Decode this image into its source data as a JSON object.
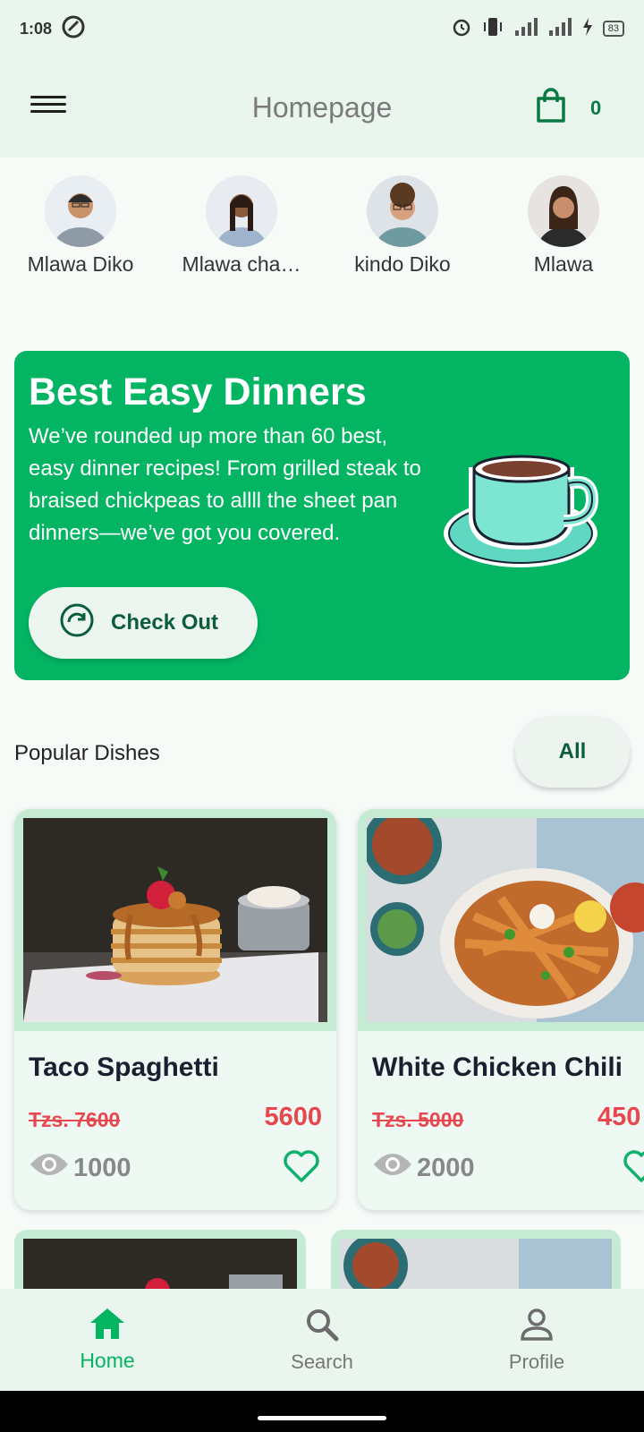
{
  "status": {
    "time": "1:08",
    "battery": "83"
  },
  "appbar": {
    "title": "Homepage",
    "cart_count": "0"
  },
  "stories": [
    {
      "name": "Mlawa Diko"
    },
    {
      "name": "Mlawa cha…"
    },
    {
      "name": "kindo Diko"
    },
    {
      "name": "Mlawa"
    }
  ],
  "banner": {
    "title": "Best Easy Dinners",
    "text": "We’ve rounded up more than 60 best, easy dinner recipes! From grilled steak to braised chickpeas to allll the sheet pan dinners—we’ve got you covered.",
    "button_label": "Check Out"
  },
  "popular": {
    "title": "Popular Dishes",
    "filter_label": "All"
  },
  "dishes": [
    {
      "name": "Taco Spaghetti",
      "old_price": "Tzs. 7600",
      "price": "5600",
      "views": "1000"
    },
    {
      "name": "White Chicken Chili",
      "old_price": "Tzs. 5000",
      "price": "450",
      "views": "2000"
    }
  ],
  "nav": {
    "home": "Home",
    "search": "Search",
    "profile": "Profile"
  },
  "colors": {
    "accent": "#03b563",
    "price": "#e8474f",
    "dark_green": "#0b5e37"
  }
}
